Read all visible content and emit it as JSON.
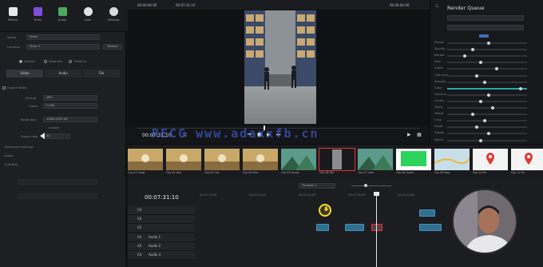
{
  "toolbar": {
    "tools": [
      {
        "label": "Effects",
        "icon": "effects-icon",
        "color": "#c5c8cc"
      },
      {
        "label": "Titles",
        "icon": "titles-icon",
        "color": "#7d4fd6"
      },
      {
        "label": "Audio",
        "icon": "audio-icon",
        "color": "#4fa85b"
      },
      {
        "label": "Color",
        "icon": "color-icon",
        "color": "#e1e3e6"
      },
      {
        "label": "Settings",
        "icon": "settings-icon",
        "color": "#d8dade"
      }
    ]
  },
  "inspector": {
    "name_label": "Name",
    "name_value": "Video",
    "location_label": "Location",
    "location_value": "Video 1",
    "browse_label": "Browse",
    "option1": "Default",
    "option2": "Separate",
    "option3": "Timeline",
    "tabs": [
      "Video",
      "Audio",
      "File"
    ],
    "export_label": "Export Video",
    "format_label": "Format",
    "format_value": "MP4",
    "codec_label": "Codec",
    "codec_value": "H.264",
    "resolution_label": "Resolution",
    "resolution_value": "1080x1920 HD",
    "framerate_label": "Frame rate",
    "framerate_value": "30",
    "custom_label": "Custom",
    "advanced_label": "Advanced Settings",
    "audio_label": "Audio",
    "subtitle_label": "Subtitles"
  },
  "viewer": {
    "left_timecode": "00:00:00:00",
    "mid_timecode": "00:07:31:14",
    "right_timecode": "00:00:00:00",
    "playhead_timecode": "00:07:31:10",
    "zoom": "Fit"
  },
  "right_panel": {
    "title": "Render Queue",
    "rows": [
      "Preset",
      "Quality",
      "Bitrate",
      "Size",
      "Audio",
      "Channels",
      "Sample",
      "Color",
      "Gamma",
      "Levels",
      "Track",
      "Offset",
      "Crop",
      "Scale",
      "Rotate",
      "Blend"
    ]
  },
  "thumbnails": [
    {
      "label": "Clip 01 Snow",
      "kind": "gold"
    },
    {
      "label": "Clip 02 Hall",
      "kind": "gold"
    },
    {
      "label": "Clip 03 Cat",
      "kind": "gold"
    },
    {
      "label": "Clip 04 Film",
      "kind": "gold"
    },
    {
      "label": "Clip 05 Forest",
      "kind": "teal"
    },
    {
      "label": "Clip 06 Tall",
      "kind": "warehouse"
    },
    {
      "label": "Clip 07 Lake",
      "kind": "teal"
    },
    {
      "label": "Clip 08 Green",
      "kind": "green"
    },
    {
      "label": "Clip 09 Map",
      "kind": "map"
    },
    {
      "label": "Clip 10 Pin",
      "kind": "pin"
    },
    {
      "label": "Clip 11 Pin",
      "kind": "pin"
    }
  ],
  "timeline": {
    "timecode": "00:07:31:10",
    "timeline_select": "Timeline 1",
    "ruler": [
      "00:07:10:00",
      "00:07:16:00",
      "00:07:22:00",
      "00:07:28:00",
      "00:07:34:00"
    ],
    "tracks": [
      {
        "id": "V3",
        "name": ""
      },
      {
        "id": "V2",
        "name": ""
      },
      {
        "id": "V1",
        "name": ""
      },
      {
        "id": "A1",
        "name": "Audio 1"
      },
      {
        "id": "A2",
        "name": "Audio 2"
      },
      {
        "id": "A3",
        "name": "Audio 3"
      }
    ]
  },
  "watermark": "RECG www.adaxxfb.cn",
  "colors": {
    "accent": "#3aa0c8",
    "selection": "#e0353a",
    "cursor": "#f0e028"
  }
}
